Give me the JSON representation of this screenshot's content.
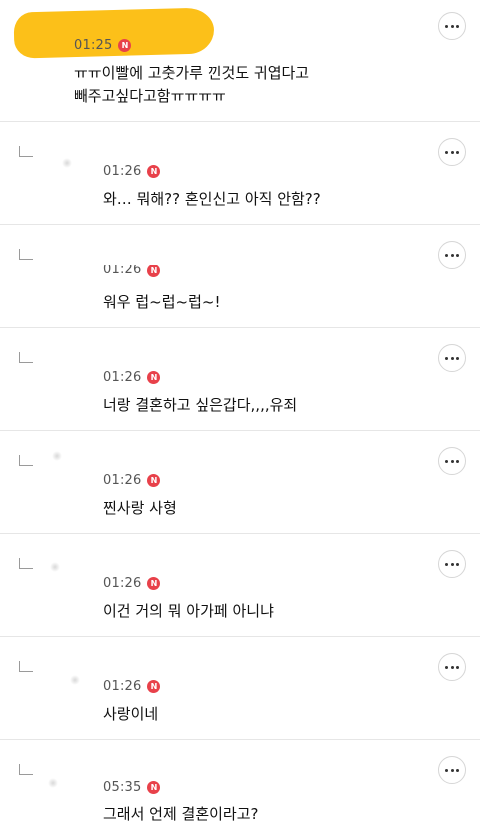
{
  "comments": [
    {
      "time": "01:25",
      "badge": "N",
      "text_lines": [
        "ㅠㅠ이빨에 고춧가루 낀것도 귀엽다고",
        "빼주고싶다고함ㅠㅠㅠㅠ"
      ]
    },
    {
      "time": "01:26",
      "badge": "N",
      "text": "와… 뭐해?? 혼인신고 아직 안함??"
    },
    {
      "time": "01:26",
      "badge": "N",
      "text": "워우 럽~럽~럽~!"
    },
    {
      "time": "01:26",
      "badge": "N",
      "text": "너랑 결혼하고 싶은갑다,,,,유죄"
    },
    {
      "time": "01:26",
      "badge": "N",
      "text": "찐사랑 사형"
    },
    {
      "time": "01:26",
      "badge": "N",
      "text": "이건 거의 뭐 아가페 아니냐"
    },
    {
      "time": "01:26",
      "badge": "N",
      "text": "사랑이네"
    },
    {
      "time": "05:35",
      "badge": "N",
      "text": "그래서 언제 결혼이라고?"
    }
  ],
  "colors": {
    "badge": "#e8414a",
    "highlight": "#fcc019",
    "divider": "#e6e6e6"
  },
  "icons": {
    "more": "more-dots-icon",
    "reply": "reply-arrow-icon",
    "new": "new-badge-icon"
  }
}
